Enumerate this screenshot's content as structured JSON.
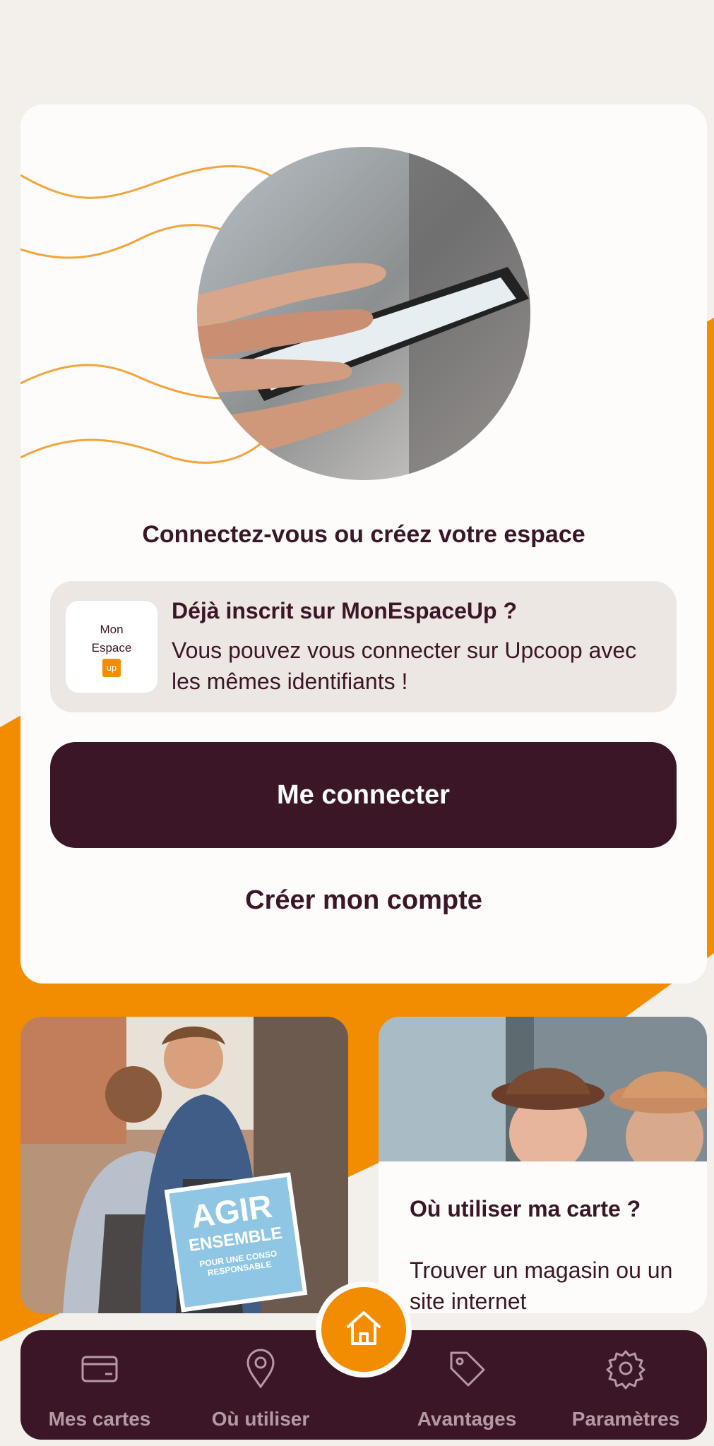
{
  "colors": {
    "brand_dark": "#3b1627",
    "accent_orange": "#f28c00",
    "card_bg": "#fdfcfb",
    "info_bg": "#ece7e2"
  },
  "hero": {
    "title": "Connectez-vous ou créez votre espace"
  },
  "info_box": {
    "logo_line1": "Mon",
    "logo_line2": "Espace",
    "logo_badge": "up",
    "title": "Déjà inscrit sur MonEspaceUp ?",
    "text": "Vous pouvez vous connecter sur Upcoop avec les mêmes identifiants !"
  },
  "actions": {
    "connect_label": "Me connecter",
    "create_label": "Créer mon compte"
  },
  "promo_card": {
    "badge_line1": "AGIR",
    "badge_line2": "ENSEMBLE",
    "badge_line3": "POUR UNE CONSO",
    "badge_line4": "RESPONSABLE"
  },
  "where_card": {
    "title": "Où utiliser ma carte ?",
    "text": "Trouver un magasin ou un site internet"
  },
  "tabbar": {
    "tabs": [
      {
        "label": "Mes cartes",
        "icon": "card-icon"
      },
      {
        "label": "Où utiliser",
        "icon": "location-pin-icon"
      },
      {
        "label": "Avantages",
        "icon": "tag-icon"
      },
      {
        "label": "Paramètres",
        "icon": "gear-icon"
      }
    ],
    "home_icon": "home-icon"
  }
}
